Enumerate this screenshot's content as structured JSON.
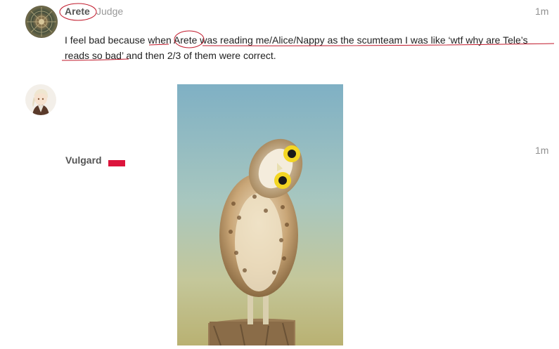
{
  "posts": [
    {
      "username": "Arete",
      "title": "Judge",
      "time": "1m",
      "body": {
        "line1a": "I feel bad because ",
        "line1b": "when ",
        "line1c": "Arete",
        "line1d": " was reading me/Alice/Nappy as the scumteam I was like ‘wtf why are Tele’s",
        "line2a": "reads so bad’",
        "line2b": " and then 2/3 of them were correct."
      }
    },
    {
      "username": "Vulgard",
      "time": "1m",
      "flair_color": "#dc143c",
      "image": "owl-photo"
    }
  ],
  "annotation_color": "#c0182a"
}
